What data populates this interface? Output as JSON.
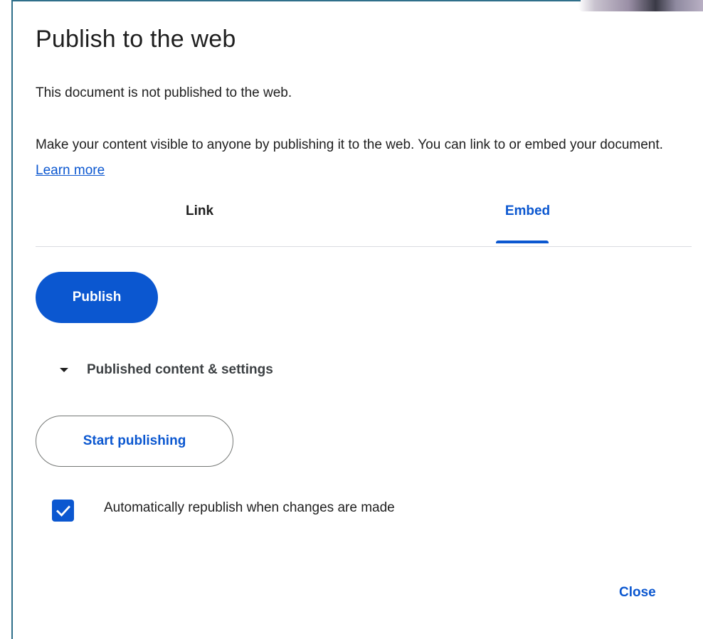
{
  "dialog": {
    "title": "Publish to the web",
    "status": "This document is not published to the web.",
    "description": "Make your content visible to anyone by publishing it to the web. You can link to or embed your document.",
    "learn_more_label": "Learn more"
  },
  "tabs": [
    {
      "label": "Link",
      "selected": false
    },
    {
      "label": "Embed",
      "selected": true
    }
  ],
  "actions": {
    "publish_label": "Publish",
    "settings_toggle_label": "Published content & settings",
    "start_publishing_label": "Start publishing",
    "close_label": "Close"
  },
  "options": {
    "auto_republish_label": "Automatically republish when changes are made",
    "auto_republish_checked": true
  },
  "colors": {
    "accent": "#0b57d0",
    "text": "#1f1f1f",
    "divider": "#dadce0"
  },
  "icons": {
    "disclosure": "caret-down-icon",
    "checkbox": "checkmark-icon"
  }
}
